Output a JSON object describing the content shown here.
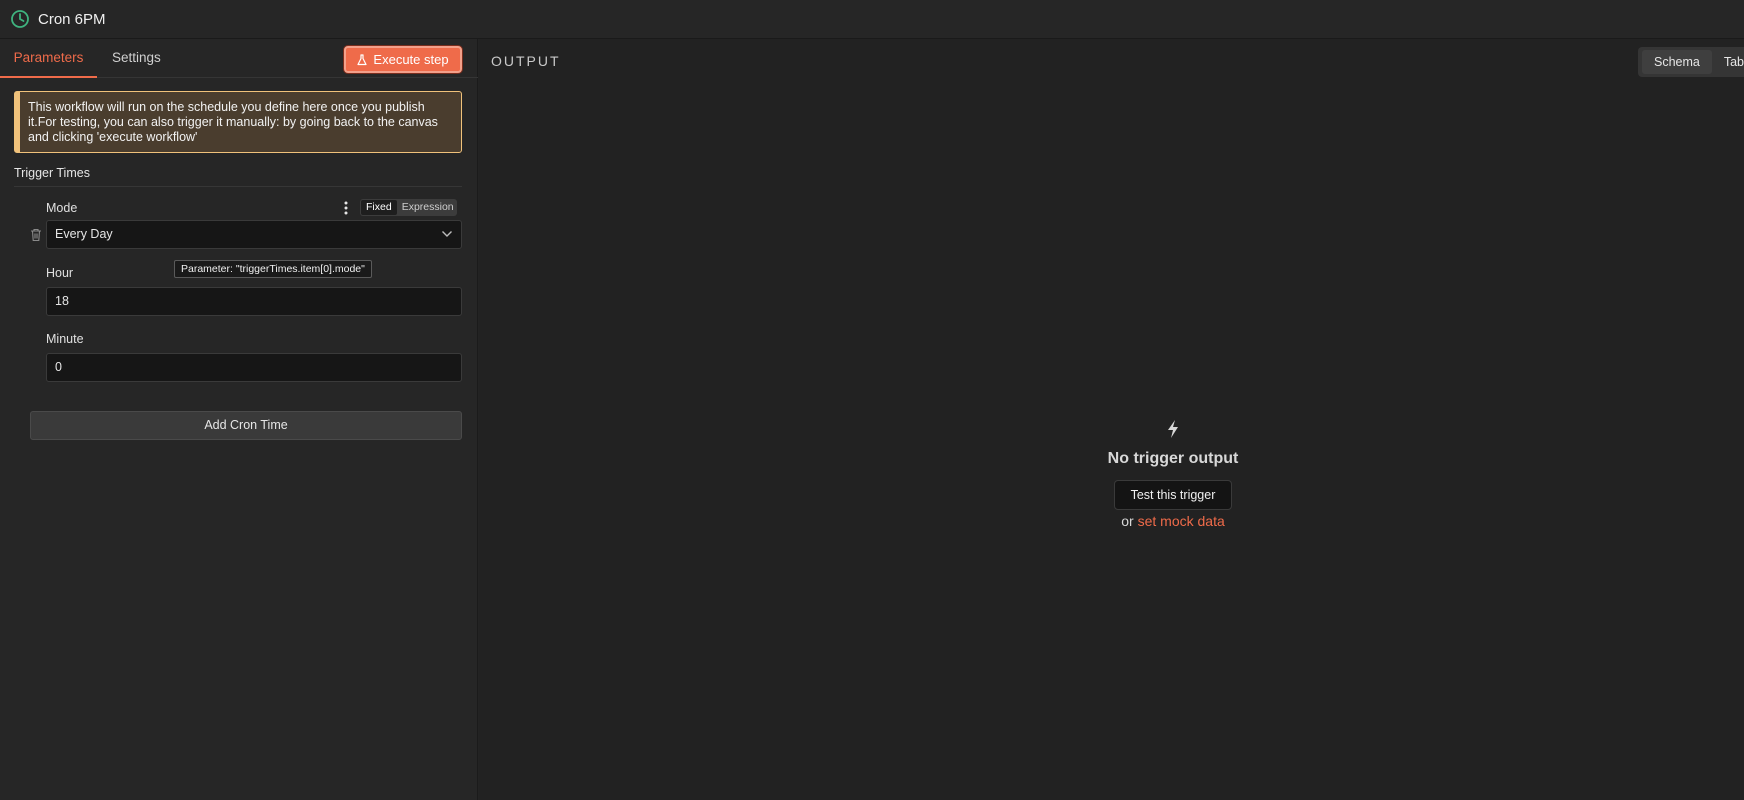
{
  "header": {
    "title": "Cron 6PM",
    "icon": "clock-icon"
  },
  "left_panel": {
    "tabs": [
      {
        "label": "Parameters",
        "active": true
      },
      {
        "label": "Settings",
        "active": false
      }
    ],
    "execute_button": {
      "label": "Execute step",
      "icon": "flask-icon"
    },
    "notice": "This workflow will run on the schedule you define here once you publish it.For testing, you can also trigger it manually: by going back to the canvas and clicking 'execute workflow'",
    "section_label": "Trigger Times",
    "mode": {
      "label": "Mode",
      "value": "Every Day",
      "toggle": {
        "fixed": "Fixed",
        "expression": "Expression",
        "active": "Fixed"
      }
    },
    "tooltip": "Parameter: \"triggerTimes.item[0].mode\"",
    "hour": {
      "label": "Hour",
      "value": "18"
    },
    "minute": {
      "label": "Minute",
      "value": "0"
    },
    "add_button": "Add Cron Time"
  },
  "right_panel": {
    "output_label": "OUTPUT",
    "view_tabs": [
      {
        "label": "Schema",
        "active": true
      },
      {
        "label": "Table",
        "active": false
      }
    ],
    "empty_state": {
      "icon": "bolt-icon",
      "title": "No trigger output",
      "test_button": "Test this trigger",
      "or_text": "or",
      "mock_link": "set mock data"
    }
  },
  "colors": {
    "accent": "#ef6b4a",
    "background": "#232323",
    "notice_bg": "#4a3d2e",
    "notice_border": "#f0c27b",
    "clock_icon": "#3fb37f"
  }
}
